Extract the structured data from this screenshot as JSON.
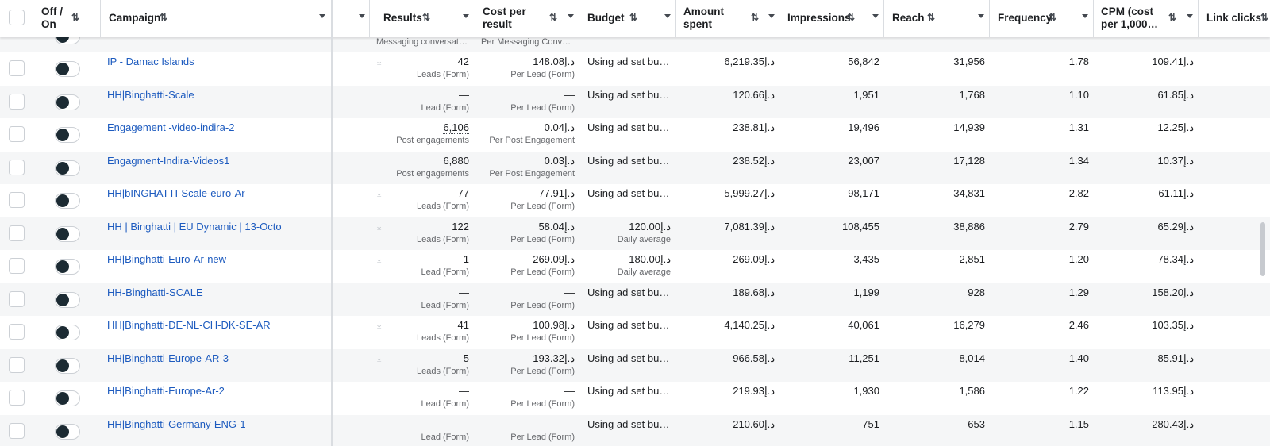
{
  "columns": {
    "off_on": "Off /\nOn",
    "campaign": "Campaign",
    "results": "Results",
    "cost_per_result": "Cost per\nresult",
    "budget": "Budget",
    "amount_spent": "Amount\nspent",
    "impressions": "Impressions",
    "reach": "Reach",
    "frequency": "Frequency",
    "cpm": "CPM (cost\nper 1,000…",
    "link_clicks": "Link clicks"
  },
  "sort_glyph": "⇅",
  "partial_row": {
    "result_type": "Messaging conversat…",
    "cost_type": "Per Messaging Conv…"
  },
  "rows": [
    {
      "campaign": "IP - Damac Islands",
      "results": "42",
      "result_type": "Leads (Form)",
      "cpr": "148.08د.إ",
      "cpr_type": "Per Lead (Form)",
      "budget": "Using ad set bu…",
      "budget_sub": "",
      "spent": "6,219.35د.إ",
      "impressions": "56,842",
      "reach": "31,956",
      "frequency": "1.78",
      "cpm": "109.41د.إ",
      "download": true
    },
    {
      "campaign": "HH|Binghatti-Scale",
      "results": "—",
      "result_type": "Lead (Form)",
      "cpr": "—",
      "cpr_type": "Per Lead (Form)",
      "budget": "Using ad set bu…",
      "budget_sub": "",
      "spent": "120.66د.إ",
      "impressions": "1,951",
      "reach": "1,768",
      "frequency": "1.10",
      "cpm": "61.85د.إ",
      "download": false
    },
    {
      "campaign": "Engagement -video-indira-2",
      "results": "6,106",
      "result_type": "Post engagements",
      "cpr": "0.04د.إ",
      "cpr_type": "Per Post Engagement",
      "budget": "Using ad set bu…",
      "budget_sub": "",
      "spent": "238.81د.إ",
      "impressions": "19,496",
      "reach": "14,939",
      "frequency": "1.31",
      "cpm": "12.25د.إ",
      "download": false,
      "underline": true
    },
    {
      "campaign": "Engagment-Indira-Videos1",
      "results": "6,880",
      "result_type": "Post engagements",
      "cpr": "0.03د.إ",
      "cpr_type": "Per Post Engagement",
      "budget": "Using ad set bu…",
      "budget_sub": "",
      "spent": "238.52د.إ",
      "impressions": "23,007",
      "reach": "17,128",
      "frequency": "1.34",
      "cpm": "10.37د.إ",
      "download": false,
      "underline": true
    },
    {
      "campaign": "HH|bINGHATTI-Scale-euro-Ar",
      "results": "77",
      "result_type": "Leads (Form)",
      "cpr": "77.91د.إ",
      "cpr_type": "Per Lead (Form)",
      "budget": "Using ad set bu…",
      "budget_sub": "",
      "spent": "5,999.27د.إ",
      "impressions": "98,171",
      "reach": "34,831",
      "frequency": "2.82",
      "cpm": "61.11د.إ",
      "download": true
    },
    {
      "campaign": "HH | Binghatti | EU Dynamic | 13-Octo",
      "results": "122",
      "result_type": "Leads (Form)",
      "cpr": "58.04د.إ",
      "cpr_type": "Per Lead (Form)",
      "budget": "120.00د.إ",
      "budget_sub": "Daily average",
      "spent": "7,081.39د.إ",
      "impressions": "108,455",
      "reach": "38,886",
      "frequency": "2.79",
      "cpm": "65.29د.إ",
      "download": true
    },
    {
      "campaign": "HH|Binghatti-Euro-Ar-new",
      "results": "1",
      "result_type": "Lead (Form)",
      "cpr": "269.09د.إ",
      "cpr_type": "Per Lead (Form)",
      "budget": "180.00د.إ",
      "budget_sub": "Daily average",
      "spent": "269.09د.إ",
      "impressions": "3,435",
      "reach": "2,851",
      "frequency": "1.20",
      "cpm": "78.34د.إ",
      "download": true
    },
    {
      "campaign": "HH-Binghatti-SCALE",
      "results": "—",
      "result_type": "Lead (Form)",
      "cpr": "—",
      "cpr_type": "Per Lead (Form)",
      "budget": "Using ad set bu…",
      "budget_sub": "",
      "spent": "189.68د.إ",
      "impressions": "1,199",
      "reach": "928",
      "frequency": "1.29",
      "cpm": "158.20د.إ",
      "download": false
    },
    {
      "campaign": "HH|Binghatti-DE-NL-CH-DK-SE-AR",
      "results": "41",
      "result_type": "Leads (Form)",
      "cpr": "100.98د.إ",
      "cpr_type": "Per Lead (Form)",
      "budget": "Using ad set bu…",
      "budget_sub": "",
      "spent": "4,140.25د.إ",
      "impressions": "40,061",
      "reach": "16,279",
      "frequency": "2.46",
      "cpm": "103.35د.إ",
      "download": true
    },
    {
      "campaign": "HH|Binghatti-Europe-AR-3",
      "results": "5",
      "result_type": "Leads (Form)",
      "cpr": "193.32د.إ",
      "cpr_type": "Per Lead (Form)",
      "budget": "Using ad set bu…",
      "budget_sub": "",
      "spent": "966.58د.إ",
      "impressions": "11,251",
      "reach": "8,014",
      "frequency": "1.40",
      "cpm": "85.91د.إ",
      "download": true
    },
    {
      "campaign": "HH|Binghatti-Europe-Ar-2",
      "results": "—",
      "result_type": "Lead (Form)",
      "cpr": "—",
      "cpr_type": "Per Lead (Form)",
      "budget": "Using ad set bu…",
      "budget_sub": "",
      "spent": "219.93د.إ",
      "impressions": "1,930",
      "reach": "1,586",
      "frequency": "1.22",
      "cpm": "113.95د.إ",
      "download": false
    },
    {
      "campaign": "HH|Binghatti-Germany-ENG-1",
      "results": "—",
      "result_type": "Lead (Form)",
      "cpr": "—",
      "cpr_type": "Per Lead (Form)",
      "budget": "Using ad set bu…",
      "budget_sub": "",
      "spent": "210.60د.إ",
      "impressions": "751",
      "reach": "653",
      "frequency": "1.15",
      "cpm": "280.43د.إ",
      "download": false
    }
  ],
  "download_glyph": "⤓",
  "colors": {
    "link": "#1d5bbf",
    "alt_row": "#f5f6f7",
    "toggle_knob": "#1c2b33"
  }
}
